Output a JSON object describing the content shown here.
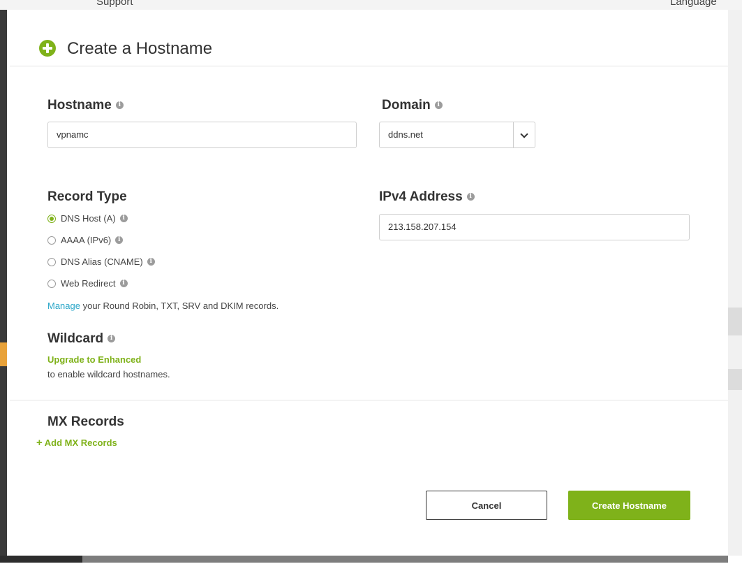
{
  "background": {
    "topbar": {
      "support": "Support",
      "language": "Language"
    }
  },
  "modal": {
    "title": "Create a Hostname",
    "hostname": {
      "label": "Hostname",
      "value": "vpnamc"
    },
    "domain": {
      "label": "Domain",
      "value": "ddns.net"
    },
    "record_type": {
      "label": "Record Type",
      "options": [
        {
          "label": "DNS Host (A)",
          "checked": true
        },
        {
          "label": "AAAA (IPv6)",
          "checked": false
        },
        {
          "label": "DNS Alias (CNAME)",
          "checked": false
        },
        {
          "label": "Web Redirect",
          "checked": false
        }
      ]
    },
    "ipv4": {
      "label": "IPv4 Address",
      "value": "213.158.207.154"
    },
    "manage": {
      "link": "Manage",
      "text": " your Round Robin, TXT, SRV and DKIM records."
    },
    "wildcard": {
      "label": "Wildcard",
      "upgrade_link": "Upgrade to Enhanced",
      "description": "to enable wildcard hostnames."
    },
    "mx": {
      "label": "MX Records",
      "add_link": "Add MX Records"
    },
    "buttons": {
      "cancel": "Cancel",
      "create": "Create Hostname"
    }
  },
  "colors": {
    "accent": "#7fb21a",
    "link": "#2aa6c8"
  }
}
